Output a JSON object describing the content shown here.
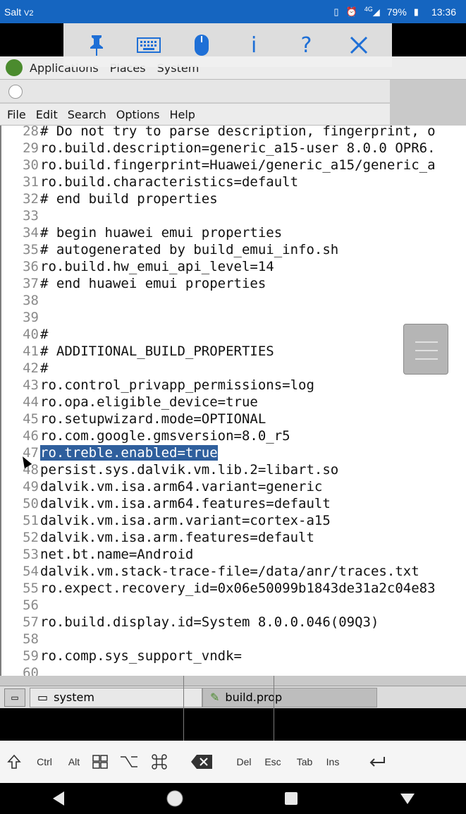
{
  "statusbar": {
    "carrier": "Salt",
    "battery": "79%",
    "time": "13:36",
    "network": "4G"
  },
  "vnc_toolbar": {
    "info": "i",
    "help": "?"
  },
  "panel": {
    "items": [
      "Applications",
      "Places",
      "System"
    ]
  },
  "menubar": {
    "items": [
      "File",
      "Edit",
      "Search",
      "Options",
      "Help"
    ]
  },
  "editor": {
    "selected_line": 47,
    "lines": [
      {
        "n": "28",
        "t": "# Do not try to parse description, fingerprint, o"
      },
      {
        "n": "29",
        "t": "ro.build.description=generic_a15-user 8.0.0 OPR6."
      },
      {
        "n": "30",
        "t": "ro.build.fingerprint=Huawei/generic_a15/generic_a"
      },
      {
        "n": "31",
        "t": "ro.build.characteristics=default"
      },
      {
        "n": "32",
        "t": "# end build properties"
      },
      {
        "n": "33",
        "t": ""
      },
      {
        "n": "34",
        "t": "# begin huawei emui properties"
      },
      {
        "n": "35",
        "t": "# autogenerated by build_emui_info.sh"
      },
      {
        "n": "36",
        "t": "ro.build.hw_emui_api_level=14"
      },
      {
        "n": "37",
        "t": "# end huawei emui properties"
      },
      {
        "n": "38",
        "t": ""
      },
      {
        "n": "39",
        "t": ""
      },
      {
        "n": "40",
        "t": "#"
      },
      {
        "n": "41",
        "t": "# ADDITIONAL_BUILD_PROPERTIES"
      },
      {
        "n": "42",
        "t": "#"
      },
      {
        "n": "43",
        "t": "ro.control_privapp_permissions=log"
      },
      {
        "n": "44",
        "t": "ro.opa.eligible_device=true"
      },
      {
        "n": "45",
        "t": "ro.setupwizard.mode=OPTIONAL"
      },
      {
        "n": "46",
        "t": "ro.com.google.gmsversion=8.0_r5"
      },
      {
        "n": "47",
        "t": "ro.treble.enabled=true"
      },
      {
        "n": "48",
        "t": "persist.sys.dalvik.vm.lib.2=libart.so"
      },
      {
        "n": "49",
        "t": "dalvik.vm.isa.arm64.variant=generic"
      },
      {
        "n": "50",
        "t": "dalvik.vm.isa.arm64.features=default"
      },
      {
        "n": "51",
        "t": "dalvik.vm.isa.arm.variant=cortex-a15"
      },
      {
        "n": "52",
        "t": "dalvik.vm.isa.arm.features=default"
      },
      {
        "n": "53",
        "t": "net.bt.name=Android"
      },
      {
        "n": "54",
        "t": "dalvik.vm.stack-trace-file=/data/anr/traces.txt"
      },
      {
        "n": "55",
        "t": "ro.expect.recovery_id=0x06e50099b1843de31a2c04e83"
      },
      {
        "n": "56",
        "t": ""
      },
      {
        "n": "57",
        "t": "ro.build.display.id=System 8.0.0.046(09Q3)"
      },
      {
        "n": "58",
        "t": ""
      },
      {
        "n": "59",
        "t": "ro.comp.sys_support_vndk="
      },
      {
        "n": "60",
        "t": ""
      }
    ]
  },
  "taskbar": {
    "items": [
      "system",
      "build.prop"
    ]
  },
  "keys": [
    "Ctrl",
    "Alt",
    "Del",
    "Esc",
    "Tab",
    "Ins"
  ]
}
